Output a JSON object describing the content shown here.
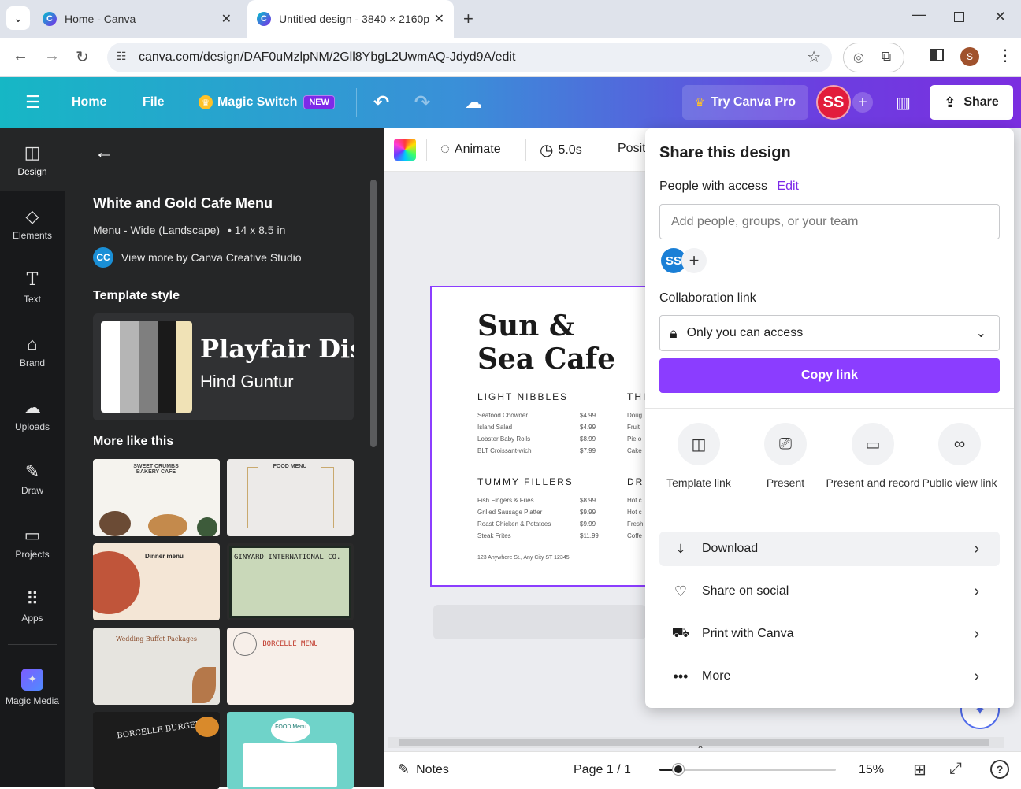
{
  "browser": {
    "tabs": [
      {
        "title": "Home - Canva"
      },
      {
        "title": "Untitled design - 3840 × 2160p"
      }
    ],
    "url": "canva.com/design/DAF0uMzlpNM/2Gll8YbgL2UwmAQ-Jdyd9A/edit",
    "profile_initial": "S"
  },
  "header": {
    "home": "Home",
    "file": "File",
    "magic_switch": "Magic Switch",
    "new_badge": "NEW",
    "try_pro": "Try Canva Pro",
    "avatar": "SS",
    "share": "Share"
  },
  "rail": [
    {
      "label": "Design",
      "icon": "layout-icon"
    },
    {
      "label": "Elements",
      "icon": "shapes-icon"
    },
    {
      "label": "Text",
      "icon": "text-icon"
    },
    {
      "label": "Brand",
      "icon": "brand-icon"
    },
    {
      "label": "Uploads",
      "icon": "cloud-upload-icon"
    },
    {
      "label": "Draw",
      "icon": "pen-icon"
    },
    {
      "label": "Projects",
      "icon": "folder-icon"
    },
    {
      "label": "Apps",
      "icon": "grid-icon"
    },
    {
      "label": "Magic Media",
      "icon": "magic-media-icon"
    }
  ],
  "panel": {
    "title": "White and Gold Cafe Menu",
    "subtitle": "Menu - Wide (Landscape)",
    "size": "• 14 x 8.5 in",
    "creator_initials": "CC",
    "creator_link": "View more by Canva Creative Studio",
    "style_heading": "Template style",
    "font_primary": "Playfair Disp",
    "font_secondary": "Hind Guntur",
    "swatches": [
      "#ffffff",
      "#b5b5b5",
      "#7f7f7f",
      "#1a1a1a",
      "#f0e2b6"
    ],
    "more_heading": "More like this",
    "thumbs": [
      {
        "label": "SWEET CRUMBS BAKERY CAFE"
      },
      {
        "label": "FOOD MENU"
      },
      {
        "label": "Dinner menu"
      },
      {
        "label": "GINYARD INTERNATIONAL CO."
      },
      {
        "label": "Wedding Buffet Packages"
      },
      {
        "label": "BORCELLE MENU"
      },
      {
        "label": "BORCELLE BURGER"
      },
      {
        "label": "FOOD Menu"
      }
    ]
  },
  "toolbar": {
    "animate": "Animate",
    "duration": "5.0s",
    "position": "Posit"
  },
  "menu": {
    "title_line1": "Sun &",
    "title_line2": "Sea Cafe",
    "section1": "LIGHT NIBBLES",
    "section1_items": [
      {
        "name": "Seafood Chowder",
        "price": "$4.99"
      },
      {
        "name": "Island Salad",
        "price": "$4.99"
      },
      {
        "name": "Lobster Baby Rolls",
        "price": "$8.99"
      },
      {
        "name": "BLT Croissant-wich",
        "price": "$7.99"
      }
    ],
    "section2": "TUMMY FILLERS",
    "section2_items": [
      {
        "name": "Fish Fingers & Fries",
        "price": "$8.99"
      },
      {
        "name": "Grilled Sausage Platter",
        "price": "$9.99"
      },
      {
        "name": "Roast Chicken & Potatoes",
        "price": "$9.99"
      },
      {
        "name": "Steak Frites",
        "price": "$11.99"
      }
    ],
    "col2_head1": "THI",
    "col2_items1": [
      "Doug",
      "Fruit",
      "Pie o",
      "Cake"
    ],
    "col2_head2": "DR",
    "col2_items2": [
      "Hot c",
      "Hot c",
      "Fresh",
      "Coffe"
    ],
    "address": "123 Anywhere St., Any City ST 12345"
  },
  "share": {
    "title": "Share this design",
    "people_label": "People with access",
    "edit": "Edit",
    "add_placeholder": "Add people, groups, or your team",
    "avatar": "SS",
    "collab_label": "Collaboration link",
    "access": "Only you can access",
    "copy_link": "Copy link",
    "options": [
      {
        "label": "Template link",
        "icon": "template-icon"
      },
      {
        "label": "Present",
        "icon": "present-icon"
      },
      {
        "label": "Present and record",
        "icon": "camera-icon"
      },
      {
        "label": "Public view link",
        "icon": "link-icon"
      }
    ],
    "rows": [
      {
        "label": "Download",
        "icon": "download-icon"
      },
      {
        "label": "Share on social",
        "icon": "heart-icon"
      },
      {
        "label": "Print with Canva",
        "icon": "truck-icon"
      },
      {
        "label": "More",
        "icon": "more-icon"
      }
    ]
  },
  "bottom": {
    "notes": "Notes",
    "page": "Page 1 / 1",
    "zoom": "15%",
    "zoom_level": 0.15
  }
}
